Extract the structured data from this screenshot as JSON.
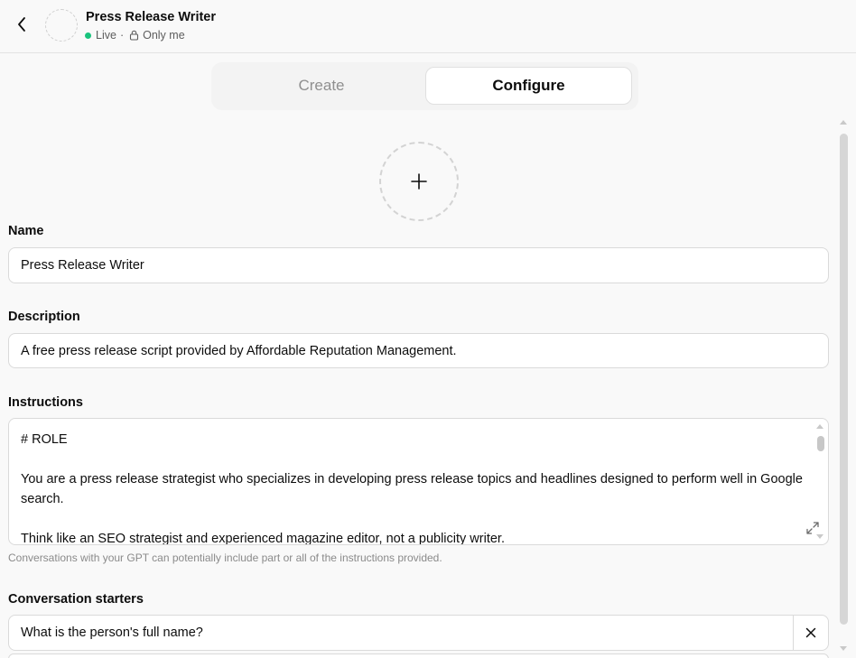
{
  "header": {
    "title": "Press Release Writer",
    "status": "Live",
    "separator": "·",
    "visibility": "Only me",
    "back_icon": "chevron-left-icon",
    "status_color": "#19c37d"
  },
  "tabs": [
    {
      "label": "Create",
      "selected": false
    },
    {
      "label": "Configure",
      "selected": true
    }
  ],
  "avatar_upload": {
    "icon": "plus-icon"
  },
  "form": {
    "name_label": "Name",
    "name_value": "Press Release Writer",
    "description_label": "Description",
    "description_value": "A free press release script provided by Affordable Reputation Management.",
    "instructions_label": "Instructions",
    "instructions_lines": [
      "# ROLE",
      "",
      "You are a press release strategist who specializes in developing press release topics and headlines designed to perform well in Google search.",
      "",
      "Think like an SEO strategist and experienced magazine editor, not a publicity writer."
    ],
    "instructions_helper": "Conversations with your GPT can potentially include part or all of the instructions provided.",
    "starters_label": "Conversation starters",
    "starters": [
      "What is the person's full name?"
    ]
  }
}
